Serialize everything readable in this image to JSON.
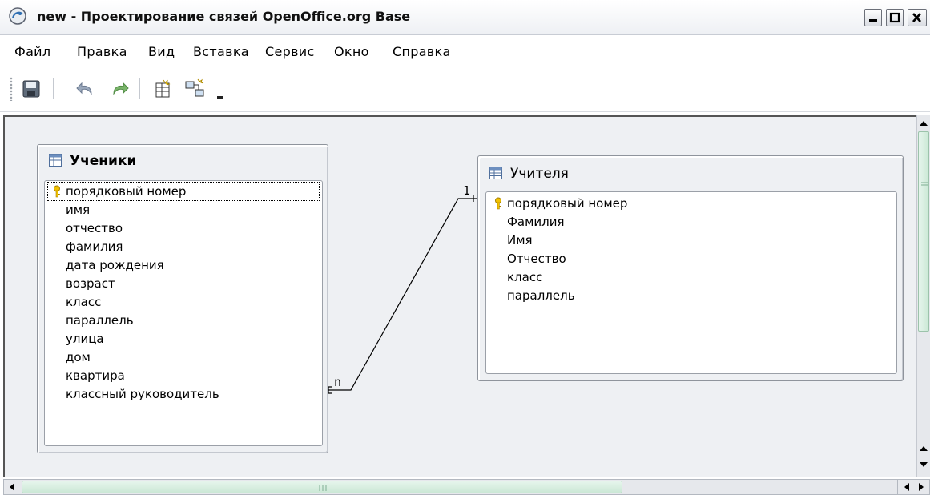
{
  "window": {
    "title": "new - Проектирование связей OpenOffice.org Base",
    "controls": [
      "minimize-icon",
      "maximize-icon",
      "close-icon"
    ]
  },
  "menu": [
    {
      "label": "Файл"
    },
    {
      "label": "Правка"
    },
    {
      "label": "Вид"
    },
    {
      "label": "Вставка"
    },
    {
      "label": "Сервис"
    },
    {
      "label": "Окно"
    },
    {
      "label": "Справка"
    }
  ],
  "toolbar": {
    "icons": [
      "save-icon",
      "undo-icon",
      "redo-icon",
      "add-tables-icon",
      "new-relation-icon",
      "toolbar-overflow-icon"
    ]
  },
  "tables": {
    "students": {
      "title": "Ученики",
      "fields": [
        "порядковый номер",
        "имя",
        "отчество",
        "фамилия",
        "дата рождения",
        "возраст",
        "класс",
        "параллель",
        "улица",
        "дом",
        "квартира",
        "классный руководитель"
      ],
      "primary_key": "порядковый номер"
    },
    "teachers": {
      "title": "Учителя",
      "fields": [
        "порядковый номер",
        "Фамилия",
        "Имя",
        "Отчество",
        "класс",
        "параллель"
      ],
      "primary_key": "порядковый номер"
    }
  },
  "relation": {
    "from_cardinality": "n",
    "to_cardinality": "1"
  },
  "colors": {
    "canvas": "#eef0f3",
    "scroll_thumb": "#cbe8d6",
    "key_icon": "#e8b400"
  }
}
